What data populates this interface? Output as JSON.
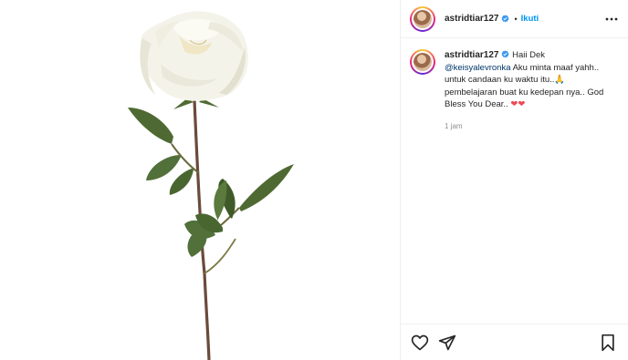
{
  "post": {
    "image_subject": "rose-image"
  },
  "header": {
    "username": "astridtiar127",
    "separator": "•",
    "follow_label": "Ikuti"
  },
  "caption": {
    "username": "astridtiar127",
    "text_before": " Haii Dek ",
    "mention": "@keisyalevronka",
    "text_after": " Aku minta maaf yahh.. untuk candaan ku waktu itu..🙏 pembelajaran buat ku kedepan nya.. God Bless You Dear.. ",
    "emoji": "❤❤",
    "time": "1 jam"
  },
  "actions": {
    "icons": [
      "heart-icon",
      "share-icon",
      "bookmark-icon"
    ]
  },
  "colors": {
    "accent": "#0095f6",
    "mention": "#00376b",
    "verified": "#3897f0",
    "heart_emoji": "#ed4956"
  }
}
